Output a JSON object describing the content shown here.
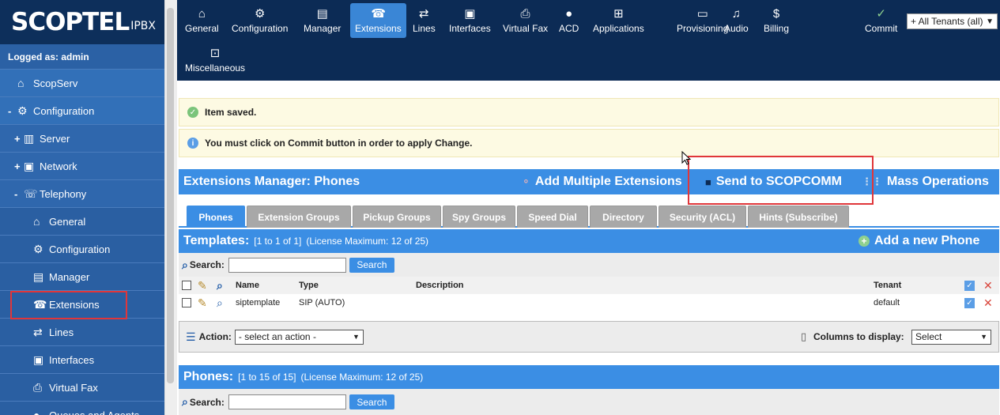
{
  "brand": {
    "name": "SCOPTEL",
    "sub": "IPBX"
  },
  "logged_as": "Logged as: admin",
  "sidebar": [
    {
      "label": "ScopServ",
      "pm": "",
      "level": "lvl0",
      "icon": "home-icon"
    },
    {
      "label": "Configuration",
      "pm": "-",
      "level": "lvl1",
      "icon": "gear-icon"
    },
    {
      "label": "Server",
      "pm": "+",
      "level": "lvl2",
      "icon": "server-icon"
    },
    {
      "label": "Network",
      "pm": "+",
      "level": "lvl2",
      "icon": "network-icon"
    },
    {
      "label": "Telephony",
      "pm": "-",
      "level": "lvl2",
      "icon": "telephony-icon"
    },
    {
      "label": "General",
      "pm": "",
      "level": "lvl3",
      "icon": "home-icon"
    },
    {
      "label": "Configuration",
      "pm": "",
      "level": "lvl3",
      "icon": "gear-icon"
    },
    {
      "label": "Manager",
      "pm": "",
      "level": "lvl3",
      "icon": "manager-icon"
    },
    {
      "label": "Extensions",
      "pm": "",
      "level": "lvl3",
      "icon": "phone-icon"
    },
    {
      "label": "Lines",
      "pm": "",
      "level": "lvl3",
      "icon": "lines-icon"
    },
    {
      "label": "Interfaces",
      "pm": "",
      "level": "lvl3",
      "icon": "interfaces-icon"
    },
    {
      "label": "Virtual Fax",
      "pm": "",
      "level": "lvl3",
      "icon": "fax-icon"
    },
    {
      "label": "Queues and Agents",
      "pm": "",
      "level": "lvl3",
      "icon": "agent-icon"
    }
  ],
  "topnav": [
    {
      "label": "General",
      "icon": "home-icon",
      "glyph": "⌂"
    },
    {
      "label": "Configuration",
      "icon": "gear-icon",
      "glyph": "⚙"
    },
    {
      "label": "Manager",
      "icon": "manager-icon",
      "glyph": "▤"
    },
    {
      "label": "Extensions",
      "icon": "phone-icon",
      "glyph": "☎"
    },
    {
      "label": "Lines",
      "icon": "lines-icon",
      "glyph": "⇄"
    },
    {
      "label": "Interfaces",
      "icon": "interfaces-icon",
      "glyph": "▣"
    },
    {
      "label": "Virtual Fax",
      "icon": "fax-icon",
      "glyph": "⎙"
    },
    {
      "label": "ACD",
      "icon": "agent-icon",
      "glyph": "●"
    },
    {
      "label": "Applications",
      "icon": "applications-icon",
      "glyph": "⊞"
    },
    {
      "label": "Provisioning",
      "icon": "provisioning-icon",
      "glyph": "▭"
    },
    {
      "label": "Audio",
      "icon": "music-icon",
      "glyph": "♫"
    },
    {
      "label": "Billing",
      "icon": "billing-icon",
      "glyph": "$"
    },
    {
      "label": "Miscellaneous",
      "icon": "misc-icon",
      "glyph": "⊡"
    },
    {
      "label": "Commit",
      "icon": "check-icon",
      "glyph": "✓"
    }
  ],
  "tenant_select": "+ All Tenants (all)",
  "messages": {
    "saved": "Item saved.",
    "commit_notice": "You must click on Commit button in order to apply Change."
  },
  "manager": {
    "title": "Extensions Manager:  Phones",
    "add_multiple": "Add Multiple Extensions",
    "send_to": "Send to SCOPCOMM",
    "mass_ops": "Mass Operations"
  },
  "tabs": [
    "Phones",
    "Extension Groups",
    "Pickup Groups",
    "Spy Groups",
    "Speed Dial",
    "Directory",
    "Security (ACL)",
    "Hints (Subscribe)"
  ],
  "templates": {
    "label": "Templates:",
    "range": "[1 to 1 of 1]",
    "license": "(License Maximum: 12 of 25)",
    "add_new": "Add a new Phone"
  },
  "search": {
    "label": "Search:",
    "button": "Search"
  },
  "table": {
    "headers": {
      "name": "Name",
      "type": "Type",
      "description": "Description",
      "tenant": "Tenant"
    },
    "rows": [
      {
        "name": "siptemplate",
        "type": "SIP (AUTO)",
        "description": "",
        "tenant": "default"
      }
    ]
  },
  "action": {
    "label": "Action:",
    "select": "- select an action -",
    "columns_label": "Columns to display:",
    "columns_select": "Select"
  },
  "phones": {
    "label": "Phones:",
    "range": "[1 to 15 of 15]",
    "license": "(License Maximum: 12 of 25)"
  }
}
